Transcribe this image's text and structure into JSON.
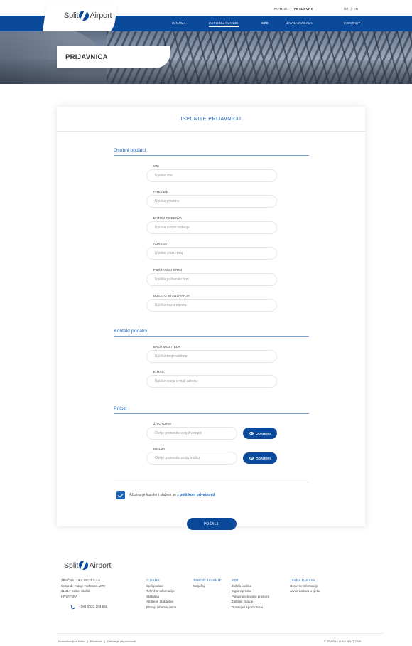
{
  "top": {
    "links": [
      "PUTNICI",
      "|",
      "POSLOVNO"
    ],
    "lang": [
      "HR",
      "|",
      "EN"
    ]
  },
  "logo": {
    "left": "Split",
    "right": "Airport"
  },
  "nav": {
    "items": [
      "O NAMA",
      "ZAPOŠLJAVANJE",
      "SZB",
      "JAVNA NABAVA",
      "KONTAKT"
    ],
    "active": "ZAPOŠLJAVANJE"
  },
  "page_title": "PRIJAVNICA",
  "form": {
    "title": "ISPUNITE PRIJAVNICU",
    "sections": {
      "personal": "Osobni podatci",
      "contact": "Kontakt podatci",
      "attachments": "Prilozi"
    },
    "fields": {
      "ime": {
        "label": "IME",
        "placeholder": "Upišite ime"
      },
      "prezime": {
        "label": "PREZIME",
        "placeholder": "Upišite prezime"
      },
      "datum": {
        "label": "DATUM ROĐENJA",
        "placeholder": "Upišite datum rođenja"
      },
      "adresa": {
        "label": "ADRESA",
        "placeholder": "Upišite ulicu i broj"
      },
      "postanski": {
        "label": "POŠTANSKI BROJ",
        "placeholder": "Upišite poštanski broj"
      },
      "mjesto": {
        "label": "MJESTO STANOVANJA",
        "placeholder": "Upišite naziv mjesta"
      },
      "mobitel": {
        "label": "BROJ MOBITELA",
        "placeholder": "Upišite broj mobitela"
      },
      "email": {
        "label": "E-MAIL",
        "placeholder": "Upišite svoju e-mail adresu"
      },
      "zivotopis": {
        "label": "ŽIVOTOPIS",
        "placeholder": "Ovdje prenesite svoj životopis"
      },
      "molba": {
        "label": "MOLBA",
        "placeholder": "Ovdje prenesite svoju molbu"
      }
    },
    "pick_label": "ODABERI",
    "consent_text": "Ažuriranje lozinke i slažem se s",
    "consent_link": "politikom privatnosti",
    "submit_label": "POŠALJI"
  },
  "footer": {
    "logo_left": "Split",
    "logo_right": "Airport",
    "address": [
      "ZRAČNA LUKA SPLIT d.o.o.",
      "Cesta dr. Franje Tuđmana 1270",
      "21 217 Kaštel Štafilić",
      "HRVATSKA"
    ],
    "phone": "+385 (0)21 203 555",
    "columns": [
      {
        "head": "O NAMA",
        "items": [
          "Opći podatci",
          "Tehničke informacije",
          "Statistika",
          "Ambient, zrakoplovi",
          "Pristup informacijama"
        ]
      },
      {
        "head": "ZAPOŠLJAVANJE",
        "items": [
          "Natječaj"
        ]
      },
      {
        "head": "SZB",
        "items": [
          "Zaštita okoliša",
          "Sigurni prostor",
          "Pokupi poslovanje prostora",
          "Zaštitne zarade",
          "Donacije i sponzorstvo"
        ]
      },
      {
        "head": "JAVNA NABAVA",
        "items": [
          "Osnovne informacije",
          "Javna nabava u tijeku"
        ]
      }
    ],
    "bottom_links": [
      "Komunikacijske tvrtke",
      "|",
      "Privatnost",
      "|",
      "Odricanje odgovornosti"
    ],
    "copyright": "© ZRAČNA LUKA SPLIT 2020"
  }
}
